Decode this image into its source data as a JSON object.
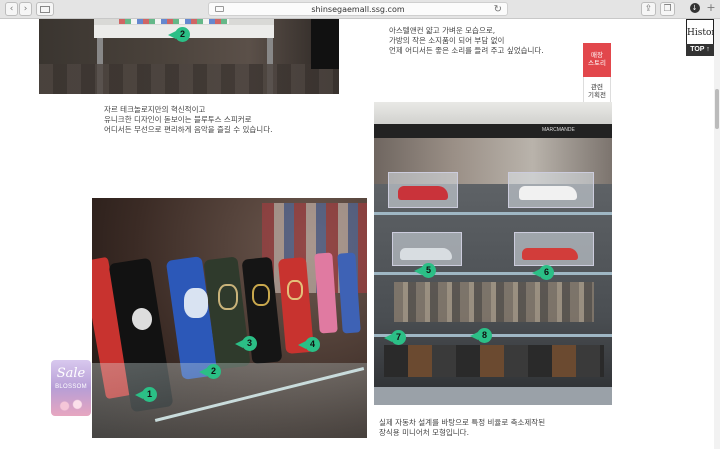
{
  "browser": {
    "url": "shinsegaemall.ssg.com",
    "back_icon": "chevron-left-icon",
    "forward_icon": "chevron-right-icon",
    "sidebar_icon": "sidebar-icon",
    "share_icon": "share-icon",
    "tabs_icon": "tabs-icon",
    "add_icon": "plus-icon",
    "download_icon": "download-icon"
  },
  "captions": {
    "top_right": [
      "아스텔앤컨 얇고 가벼운 모습으로,",
      "가방의 작은 소지품이 되어 부담 없이",
      "언제 어디서든 좋은 소리를 들려 주고 싶었습니다."
    ],
    "middle_left": [
      "자르 테크놀로지만의 혁신적이고",
      "유니크한 디자인이 돋보이는 블루투스 스피커로",
      "어디서든 무선으로 편리하게 음악을 즐길 수 있습니다."
    ],
    "bottom_right": [
      "실제 자동차 설계를 바탕으로 특정 비율로 축소제작된",
      "장식용 미니어처 모형입니다."
    ]
  },
  "markers": {
    "top": "2",
    "phones": [
      "1",
      "2",
      "3",
      "4"
    ],
    "shelf": [
      "5",
      "6",
      "7",
      "8"
    ]
  },
  "side_menu": {
    "active": [
      "매장",
      "스토리"
    ],
    "inactive": [
      "관련",
      "기획전"
    ]
  },
  "history_label": "History",
  "top_button": "TOP",
  "store_sign": "MARCMANDE",
  "sale_banner": {
    "title": "Sale",
    "subtitle": "BLOSSOM"
  },
  "colors": {
    "accent_red": "#e2474c",
    "marker_green": "#2bbf86"
  }
}
